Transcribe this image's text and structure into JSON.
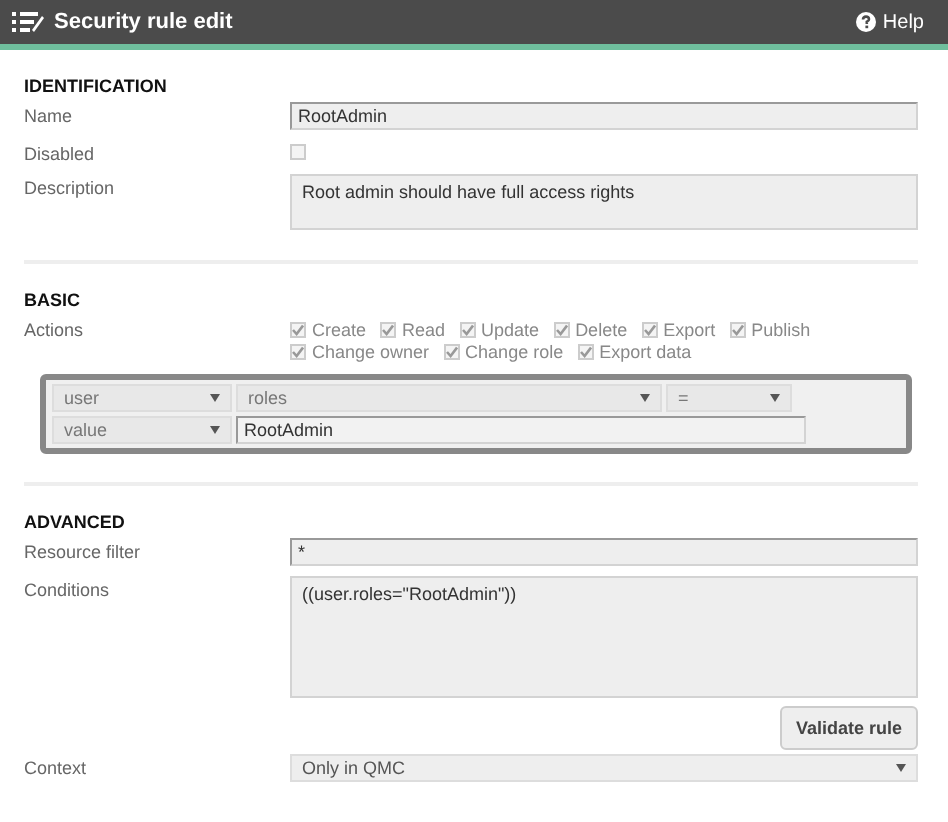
{
  "window": {
    "title": "Security rule edit",
    "help": "Help"
  },
  "identification": {
    "heading": "IDENTIFICATION",
    "name": {
      "label": "Name",
      "value": "RootAdmin"
    },
    "disabled": {
      "label": "Disabled",
      "checked": false
    },
    "description": {
      "label": "Description",
      "value": "Root admin should have full access rights"
    }
  },
  "basic": {
    "heading": "BASIC",
    "actions_label": "Actions",
    "actions": [
      {
        "label": "Create",
        "checked": true
      },
      {
        "label": "Read",
        "checked": true
      },
      {
        "label": "Update",
        "checked": true
      },
      {
        "label": "Delete",
        "checked": true
      },
      {
        "label": "Export",
        "checked": true
      },
      {
        "label": "Publish",
        "checked": true
      },
      {
        "label": "Change owner",
        "checked": true
      },
      {
        "label": "Change role",
        "checked": true
      },
      {
        "label": "Export data",
        "checked": true
      }
    ],
    "rule_rows": [
      [
        {
          "kind": "select",
          "value": "user"
        },
        {
          "kind": "select",
          "value": "roles"
        },
        {
          "kind": "select",
          "value": "="
        }
      ],
      [
        {
          "kind": "select",
          "value": "value"
        },
        {
          "kind": "input",
          "value": "RootAdmin"
        }
      ]
    ]
  },
  "advanced": {
    "heading": "ADVANCED",
    "resource_filter": {
      "label": "Resource filter",
      "value": "*"
    },
    "conditions": {
      "label": "Conditions",
      "value": "((user.roles=\"RootAdmin\"))"
    },
    "validate_button": "Validate rule",
    "context": {
      "label": "Context",
      "value": "Only in QMC"
    }
  }
}
